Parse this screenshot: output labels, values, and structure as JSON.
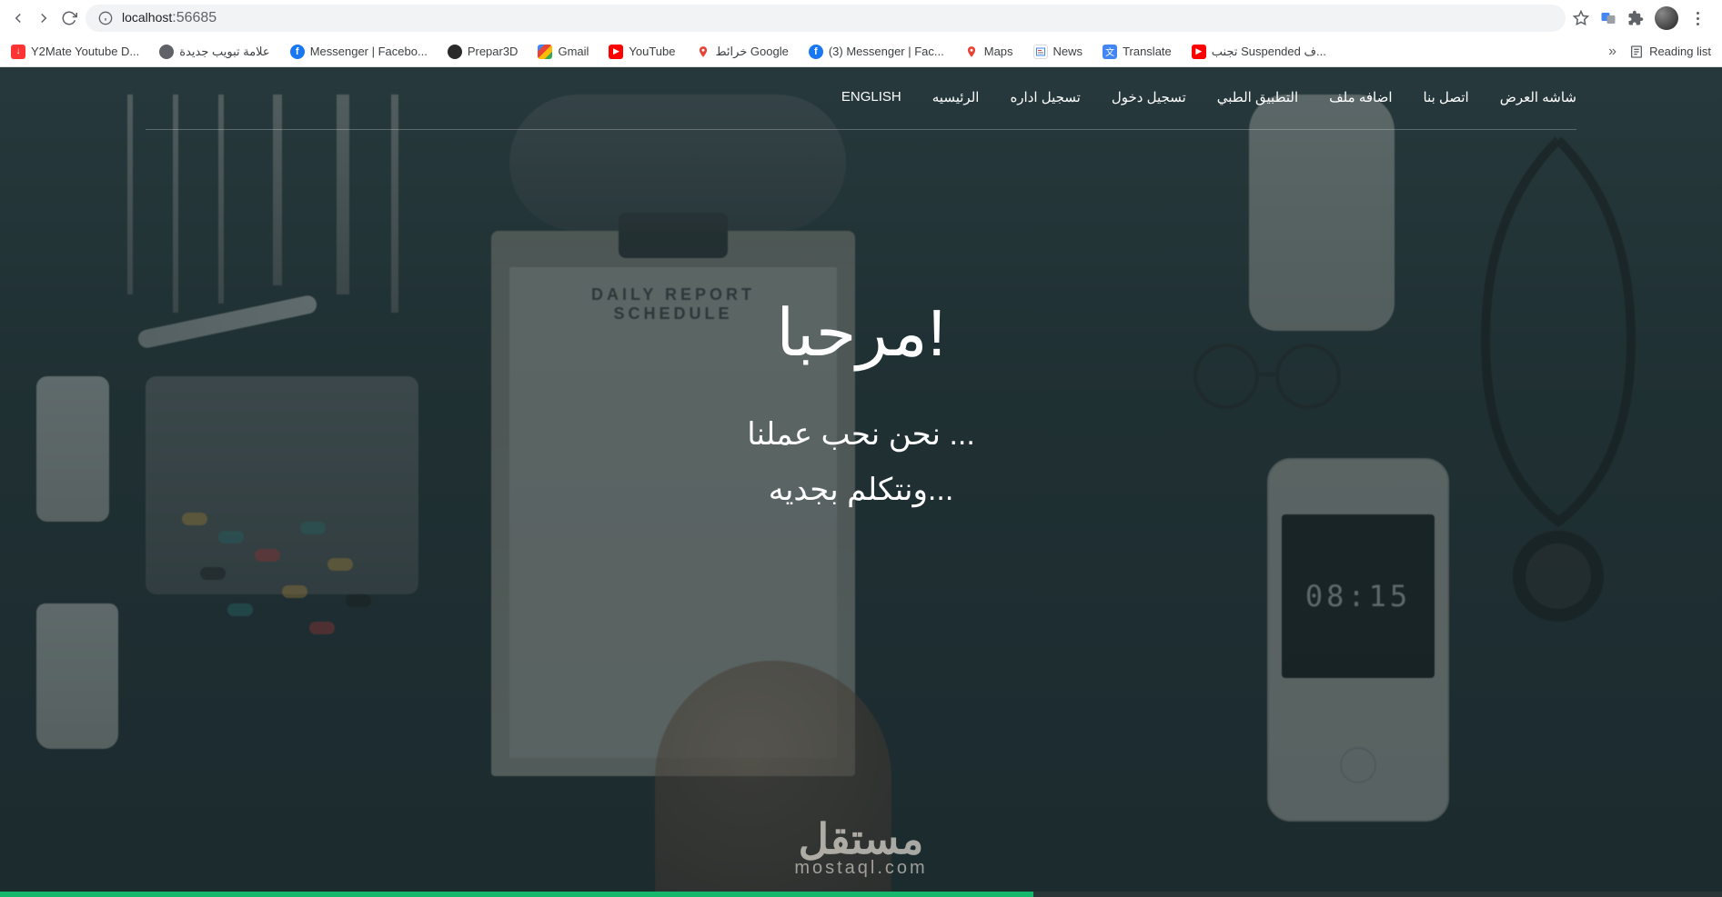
{
  "browser": {
    "url_host": "localhost",
    "url_port": ":56685"
  },
  "bookmarks": [
    {
      "label": "Y2Mate Youtube D...",
      "icon": "y2mate"
    },
    {
      "label": "علامة تبويب جديدة",
      "icon": "globe"
    },
    {
      "label": "Messenger | Facebo...",
      "icon": "fb"
    },
    {
      "label": "Prepar3D",
      "icon": "dark"
    },
    {
      "label": "Gmail",
      "icon": "gmail"
    },
    {
      "label": "YouTube",
      "icon": "yt"
    },
    {
      "label": "خرائط Google",
      "icon": "pin"
    },
    {
      "label": "(3) Messenger | Fac...",
      "icon": "fb"
    },
    {
      "label": "Maps",
      "icon": "pin"
    },
    {
      "label": "News",
      "icon": "news"
    },
    {
      "label": "Translate",
      "icon": "translate"
    },
    {
      "label": "تجنب Suspended ف...",
      "icon": "yt"
    }
  ],
  "bookmarks_right": {
    "reading_list": "Reading list"
  },
  "site_nav": [
    "شاشه العرض",
    "اتصل بنا",
    "اضافه ملف",
    "التطبيق الطبي",
    "تسجيل دخول",
    "تسجيل اداره",
    "الرئيسيه",
    "ENGLISH"
  ],
  "hero": {
    "title": "مرحبا!",
    "subtitle1": "نحن نحب عملنا ...",
    "subtitle2": "ونتكلم بجديه..."
  },
  "background": {
    "clipboard_title": "DAILY REPORT SCHEDULE",
    "phone_time": "08:15"
  },
  "watermark": {
    "ar": "مستقل",
    "en": "mostaql.com"
  }
}
